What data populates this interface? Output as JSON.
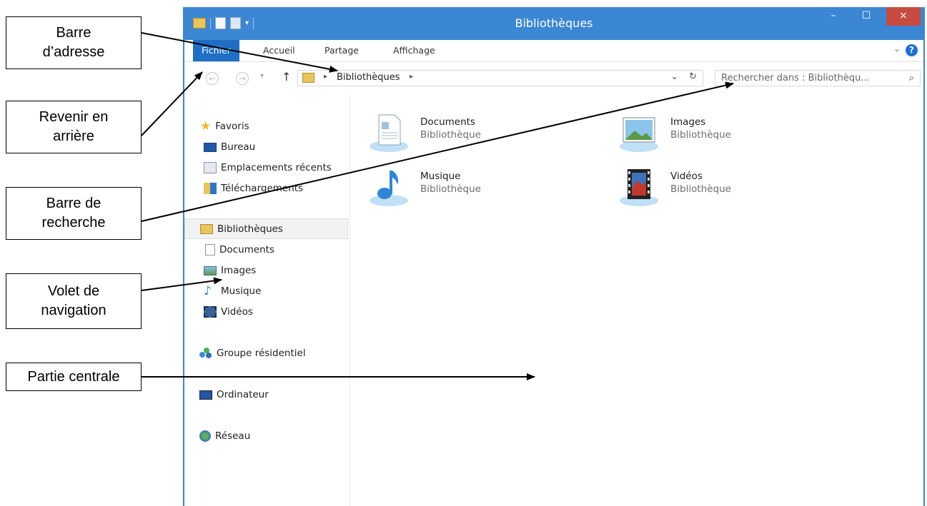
{
  "callouts": {
    "address_bar": "Barre\nd’adresse",
    "back": "Revenir en\narrière",
    "search_bar": "Barre de\nrecherche",
    "nav_pane": "Volet de\nnavigation",
    "center": "Partie centrale"
  },
  "window": {
    "title": "Bibliothèques",
    "minimize": "–",
    "maximize": "☐",
    "close": "×"
  },
  "ribbon": {
    "tabs": [
      "Fichier",
      "Accueil",
      "Partage",
      "Affichage"
    ],
    "help": "?",
    "expand": "⌄"
  },
  "address": {
    "back": "←",
    "forward": "→",
    "up": "↑",
    "separator": "▸",
    "path": "Bibliothèques",
    "dropdown": "⌄",
    "refresh": "↻",
    "search_placeholder": "Rechercher dans : Bibliothèqu...",
    "search_icon": "⌕"
  },
  "nav": {
    "favorites": "Favoris",
    "bureau": "Bureau",
    "recent": "Emplacements récents",
    "downloads": "Téléchargements",
    "libraries": "Bibliothèques",
    "documents": "Documents",
    "images": "Images",
    "music": "Musique",
    "videos": "Vidéos",
    "homegroup": "Groupe résidentiel",
    "computer": "Ordinateur",
    "network": "Réseau"
  },
  "libraries": [
    {
      "name": "Documents",
      "type": "Bibliothèque",
      "icon": "documents-library-icon"
    },
    {
      "name": "Images",
      "type": "Bibliothèque",
      "icon": "pictures-library-icon"
    },
    {
      "name": "Musique",
      "type": "Bibliothèque",
      "icon": "music-library-icon"
    },
    {
      "name": "Vidéos",
      "type": "Bibliothèque",
      "icon": "videos-library-icon"
    }
  ],
  "colors": {
    "window_frame": "#3b87d4",
    "file_tab": "#1e6fc5",
    "close_button": "#c74b3f"
  }
}
